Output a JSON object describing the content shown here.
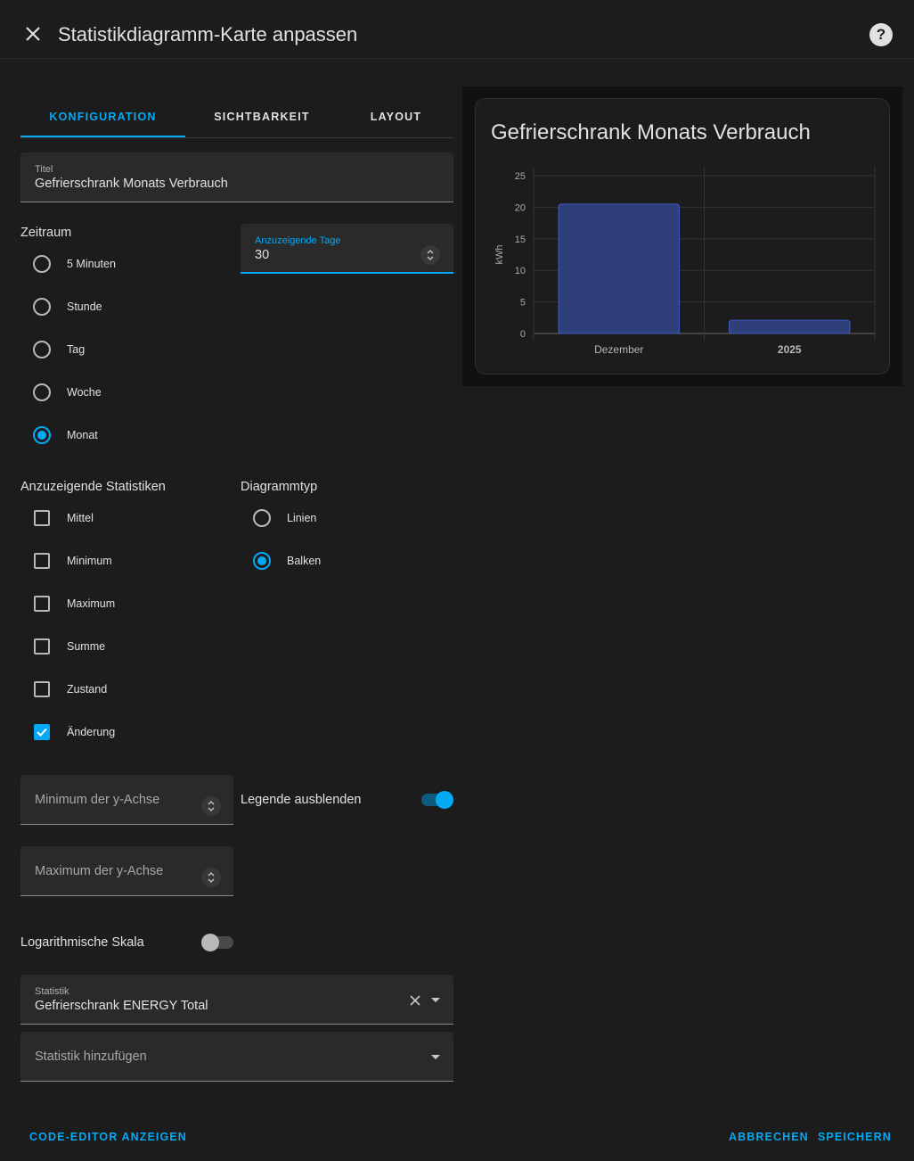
{
  "dialog": {
    "title": "Statistikdiagramm-Karte anpassen"
  },
  "tabs": [
    {
      "label": "KONFIGURATION",
      "active": true
    },
    {
      "label": "SICHTBARKEIT",
      "active": false
    },
    {
      "label": "LAYOUT",
      "active": false
    }
  ],
  "title_field": {
    "label": "Titel",
    "value": "Gefrierschrank Monats Verbrauch"
  },
  "period": {
    "label": "Zeitraum",
    "options": [
      {
        "label": "5 Minuten",
        "selected": false
      },
      {
        "label": "Stunde",
        "selected": false
      },
      {
        "label": "Tag",
        "selected": false
      },
      {
        "label": "Woche",
        "selected": false
      },
      {
        "label": "Monat",
        "selected": true
      }
    ]
  },
  "days_field": {
    "label": "Anzuzeigende Tage",
    "value": "30"
  },
  "stat_types": {
    "label": "Anzuzeigende Statistiken",
    "options": [
      {
        "label": "Mittel",
        "checked": false
      },
      {
        "label": "Minimum",
        "checked": false
      },
      {
        "label": "Maximum",
        "checked": false
      },
      {
        "label": "Summe",
        "checked": false
      },
      {
        "label": "Zustand",
        "checked": false
      },
      {
        "label": "Änderung",
        "checked": true
      }
    ]
  },
  "chart_type": {
    "label": "Diagrammtyp",
    "options": [
      {
        "label": "Linien",
        "selected": false
      },
      {
        "label": "Balken",
        "selected": true
      }
    ]
  },
  "y_min": {
    "placeholder": "Minimum der y-Achse"
  },
  "y_max": {
    "placeholder": "Maximum der y-Achse"
  },
  "hide_legend": {
    "label": "Legende ausblenden",
    "on": true
  },
  "log_scale": {
    "label": "Logarithmische Skala",
    "on": false
  },
  "statistic_field": {
    "label": "Statistik",
    "value": "Gefrierschrank ENERGY Total"
  },
  "add_statistic": {
    "placeholder": "Statistik hinzufügen"
  },
  "footer": {
    "code_editor": "CODE-EDITOR ANZEIGEN",
    "cancel": "ABBRECHEN",
    "save": "SPEICHERN"
  },
  "colors": {
    "accent": "#03a9f4",
    "bar_fill": "#2e3f7a",
    "bar_stroke": "#3d5ac4"
  },
  "chart_data": {
    "type": "bar",
    "title": "Gefrierschrank Monats Verbrauch",
    "categories": [
      "Dezember",
      "2025"
    ],
    "values": [
      20.5,
      2.1
    ],
    "ylabel": "kWh",
    "xlabel": "",
    "ylim": [
      0,
      25
    ],
    "yticks": [
      0,
      5,
      10,
      15,
      20,
      25
    ],
    "grid": true,
    "legend": "hidden"
  }
}
